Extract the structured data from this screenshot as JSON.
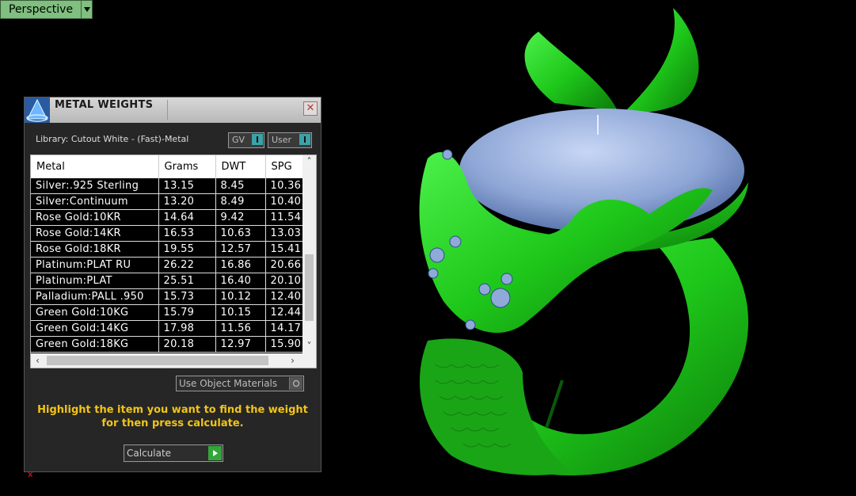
{
  "viewport": {
    "label": "Perspective"
  },
  "panel": {
    "title": "METAL WEIGHTS",
    "close_glyph": "✕",
    "library_label": "Library: Cutout White - (Fast)-Metal",
    "selector_gv": "GV",
    "selector_user": "User",
    "table": {
      "headers": [
        "Metal",
        "Grams",
        "DWT",
        "SPG"
      ],
      "rows": [
        [
          "Silver:.925 Sterling",
          "13.15",
          "8.45",
          "10.36"
        ],
        [
          "Silver:Continuum",
          "13.20",
          "8.49",
          "10.40"
        ],
        [
          "Rose Gold:10KR",
          "14.64",
          "9.42",
          "11.54"
        ],
        [
          "Rose Gold:14KR",
          "16.53",
          "10.63",
          "13.03"
        ],
        [
          "Rose Gold:18KR",
          "19.55",
          "12.57",
          "15.41"
        ],
        [
          "Platinum:PLAT RU",
          "26.22",
          "16.86",
          "20.66"
        ],
        [
          "Platinum:PLAT",
          "25.51",
          "16.40",
          "20.10"
        ],
        [
          "Palladium:PALL .950",
          "15.73",
          "10.12",
          "12.40"
        ],
        [
          "Green Gold:10KG",
          "15.79",
          "10.15",
          "12.44"
        ],
        [
          "Green Gold:14KG",
          "17.98",
          "11.56",
          "14.17"
        ],
        [
          "Green Gold:18KG",
          "20.18",
          "12.97",
          "15.90"
        ]
      ]
    },
    "use_object_materials_label": "Use Object Materials",
    "hint_line1": "Highlight the item you want to find the weight",
    "hint_line2": "for then press calculate.",
    "calculate_label": "Calculate"
  },
  "axis_marker": "x",
  "colors": {
    "ring_green": "#22c81e",
    "stone_blue": "#8fa9d8",
    "hint_yellow": "#f2c516"
  }
}
